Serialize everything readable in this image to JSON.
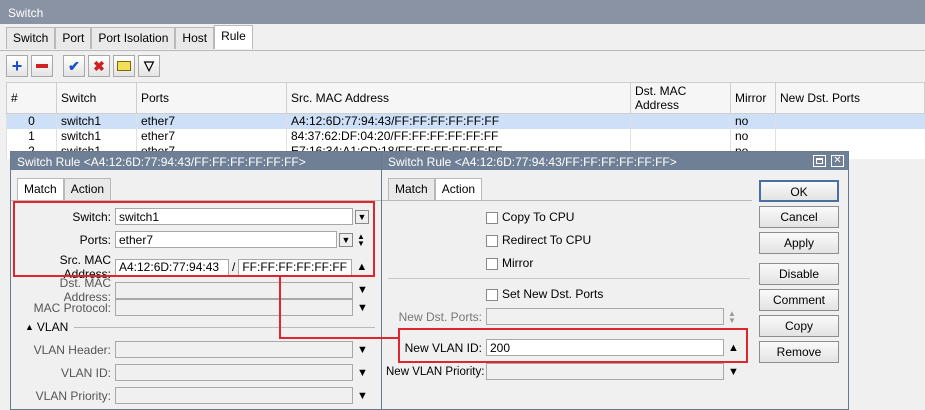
{
  "main": {
    "title": "Switch",
    "tabs": [
      {
        "label": "Switch"
      },
      {
        "label": "Port"
      },
      {
        "label": "Port Isolation"
      },
      {
        "label": "Host"
      },
      {
        "label": "Rule"
      }
    ],
    "columns": [
      "#",
      "Switch",
      "Ports",
      "Src. MAC Address",
      "Dst. MAC Address",
      "Mirror",
      "New Dst. Ports"
    ],
    "rows": [
      {
        "num": "0",
        "switch": "switch1",
        "ports": "ether7",
        "src": "A4:12:6D:77:94:43/FF:FF:FF:FF:FF:FF",
        "dst": "",
        "mirror": "no",
        "new": ""
      },
      {
        "num": "1",
        "switch": "switch1",
        "ports": "ether7",
        "src": "84:37:62:DF:04:20/FF:FF:FF:FF:FF:FF",
        "dst": "",
        "mirror": "no",
        "new": ""
      },
      {
        "num": "2",
        "switch": "switch1",
        "ports": "ether7",
        "src": "E7:16:34:A1:CD:18/FF:FF:FF:FF:FF:FF",
        "dst": "",
        "mirror": "no",
        "new": ""
      }
    ]
  },
  "left_dialog": {
    "title": "Switch Rule <A4:12:6D:77:94:43/FF:FF:FF:FF:FF:FF>",
    "tabs": {
      "match": "Match",
      "action": "Action"
    },
    "switch_label": "Switch:",
    "switch_value": "switch1",
    "ports_label": "Ports:",
    "ports_value": "ether7",
    "src_label": "Src. MAC Address:",
    "src_value": "A4:12:6D:77:94:43",
    "src_sep": "/",
    "src_mask": "FF:FF:FF:FF:FF:FF",
    "dst_label": "Dst. MAC Address:",
    "proto_label": "MAC Protocol:",
    "vlan_section": "VLAN",
    "vlan_header_label": "VLAN Header:",
    "vlan_id_label": "VLAN ID:",
    "vlan_priority_label": "VLAN Priority:"
  },
  "right_dialog": {
    "title": "Switch Rule <A4:12:6D:77:94:43/FF:FF:FF:FF:FF:FF>",
    "tabs": {
      "match": "Match",
      "action": "Action"
    },
    "copy_to_cpu": "Copy To CPU",
    "redirect_to_cpu": "Redirect To CPU",
    "mirror": "Mirror",
    "set_new_dst_ports": "Set New Dst. Ports",
    "new_dst_ports_label": "New Dst. Ports:",
    "new_vlan_id_label": "New VLAN ID:",
    "new_vlan_id_value": "200",
    "new_vlan_priority_label": "New VLAN Priority:",
    "buttons": {
      "ok": "OK",
      "cancel": "Cancel",
      "apply": "Apply",
      "disable": "Disable",
      "comment": "Comment",
      "copy": "Copy",
      "remove": "Remove"
    }
  }
}
